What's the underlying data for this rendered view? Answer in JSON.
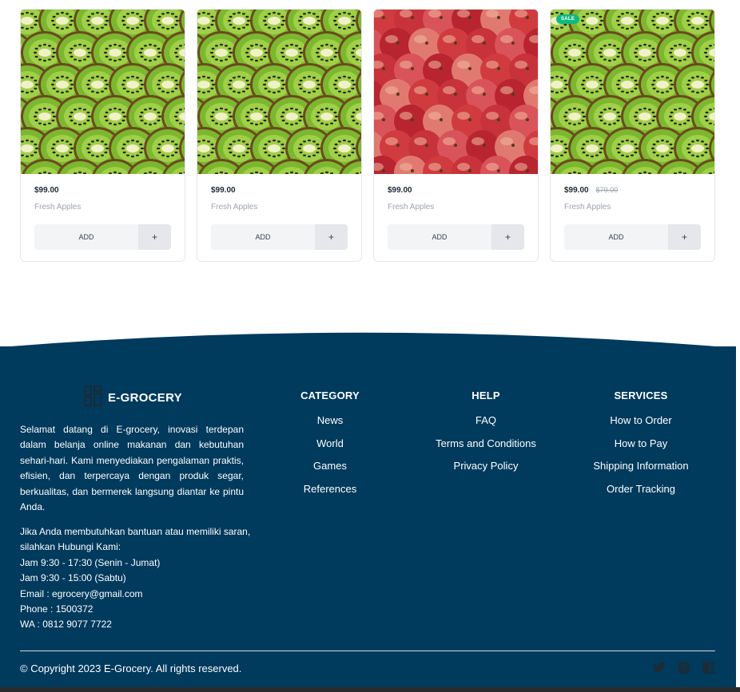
{
  "products": [
    {
      "price": "$99.00",
      "old_price": "",
      "name": "Fresh Apples",
      "add_label": "ADD",
      "plus_label": "+",
      "image": "kiwi",
      "sale": false
    },
    {
      "price": "$99.00",
      "old_price": "",
      "name": "Fresh Apples",
      "add_label": "ADD",
      "plus_label": "+",
      "image": "kiwi",
      "sale": false
    },
    {
      "price": "$99.00",
      "old_price": "",
      "name": "Fresh Apples",
      "add_label": "ADD",
      "plus_label": "+",
      "image": "apples",
      "sale": false
    },
    {
      "price": "$99.00",
      "old_price": "$79.00",
      "name": "Fresh Apples",
      "add_label": "ADD",
      "plus_label": "+",
      "image": "kiwi",
      "sale": true,
      "sale_label": "SALE"
    }
  ],
  "footer": {
    "brand": "E-GROCERY",
    "brand_icon": "grid-logo-icon",
    "about": "Selamat datang di E-grocery, inovasi terdepan dalam belanja online makanan dan kebutuhan sehari-hari. Kami menyediakan pengalaman praktis, efisien, dan terpercaya dengan produk segar, berkualitas, dan bermerek langsung diantar ke pintu Anda.",
    "contact": [
      "Jika Anda membutuhkan bantuan atau memiliki saran, silahkan Hubungi Kami:",
      "Jam 9:30 - 17:30 (Senin - Jumat)",
      "Jam 9:30 - 15:00 (Sabtu)",
      "Email : egrocery@gmail.com",
      "Phone : 1500372",
      "WA : 0812 9077 7722"
    ],
    "category": {
      "title": "CATEGORY",
      "links": [
        "News",
        "World",
        "Games",
        "References"
      ]
    },
    "help": {
      "title": "HELP",
      "links": [
        "FAQ",
        "Terms and Conditions",
        "Privacy Policy"
      ]
    },
    "services": {
      "title": "SERVICES",
      "links": [
        "How to Order",
        "How to Pay",
        "Shipping Information",
        "Order Tracking"
      ]
    },
    "copyright": "© Copyright 2023 E-Grocery. All rights reserved.",
    "social": [
      "twitter-icon",
      "instagram-icon",
      "facebook-icon"
    ]
  },
  "colors": {
    "footer_bg": "#003a5d",
    "sale_badge": "#10b981",
    "icon_dark": "#1c2b36"
  }
}
